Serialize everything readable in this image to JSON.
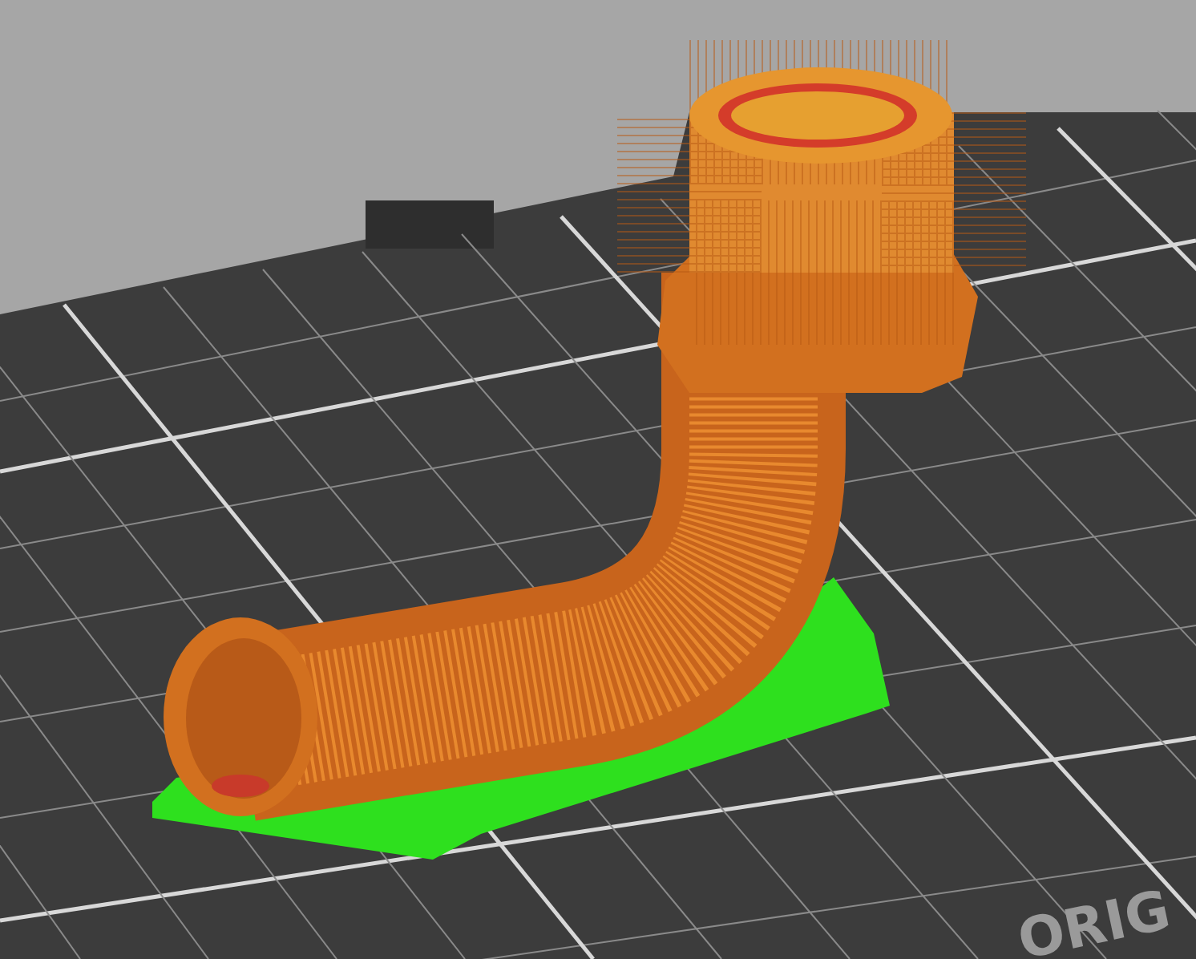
{
  "viewport": {
    "bed_label": "ORIG"
  }
}
